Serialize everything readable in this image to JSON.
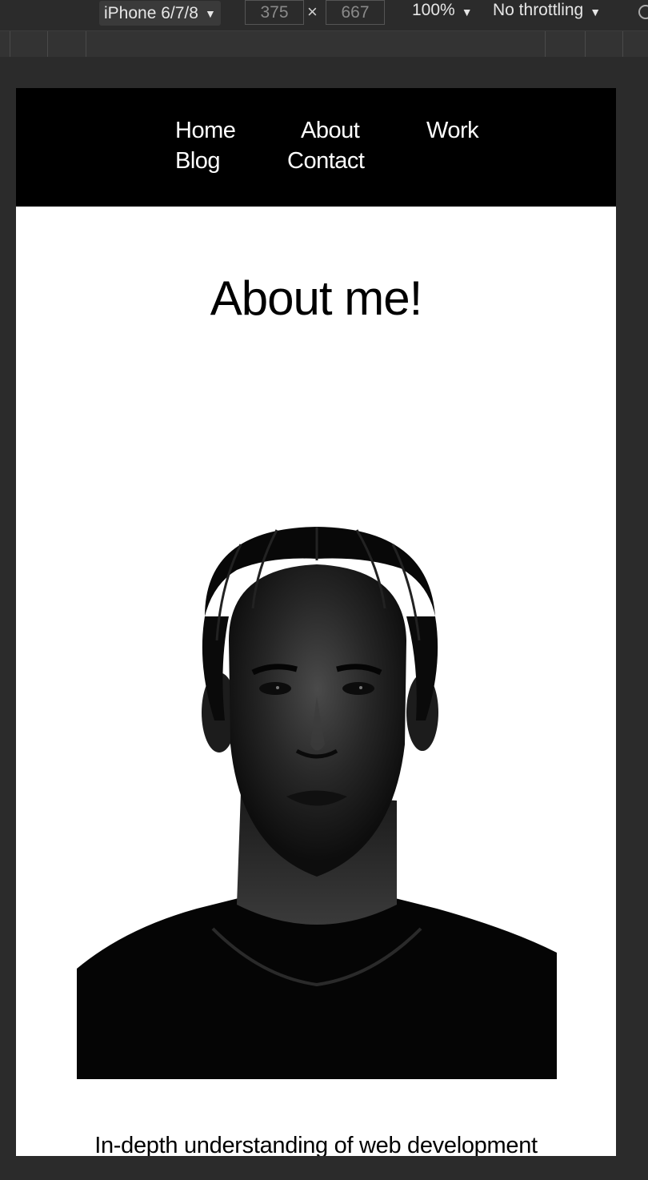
{
  "devtools": {
    "device": "iPhone 6/7/8",
    "width": "375",
    "height": "667",
    "zoom": "100%",
    "throttling": "No throttling",
    "caret": "▼",
    "times": "×"
  },
  "nav": {
    "items": [
      {
        "label": "Home"
      },
      {
        "label": "About"
      },
      {
        "label": "Work"
      },
      {
        "label": "Blog"
      },
      {
        "label": "Contact"
      }
    ]
  },
  "main": {
    "title": "About me!",
    "lead": "In-depth understanding of web development"
  },
  "colors": {
    "nav_bg": "#000000",
    "page_bg": "#ffffff",
    "devtools_bg": "#2b2b2b"
  }
}
